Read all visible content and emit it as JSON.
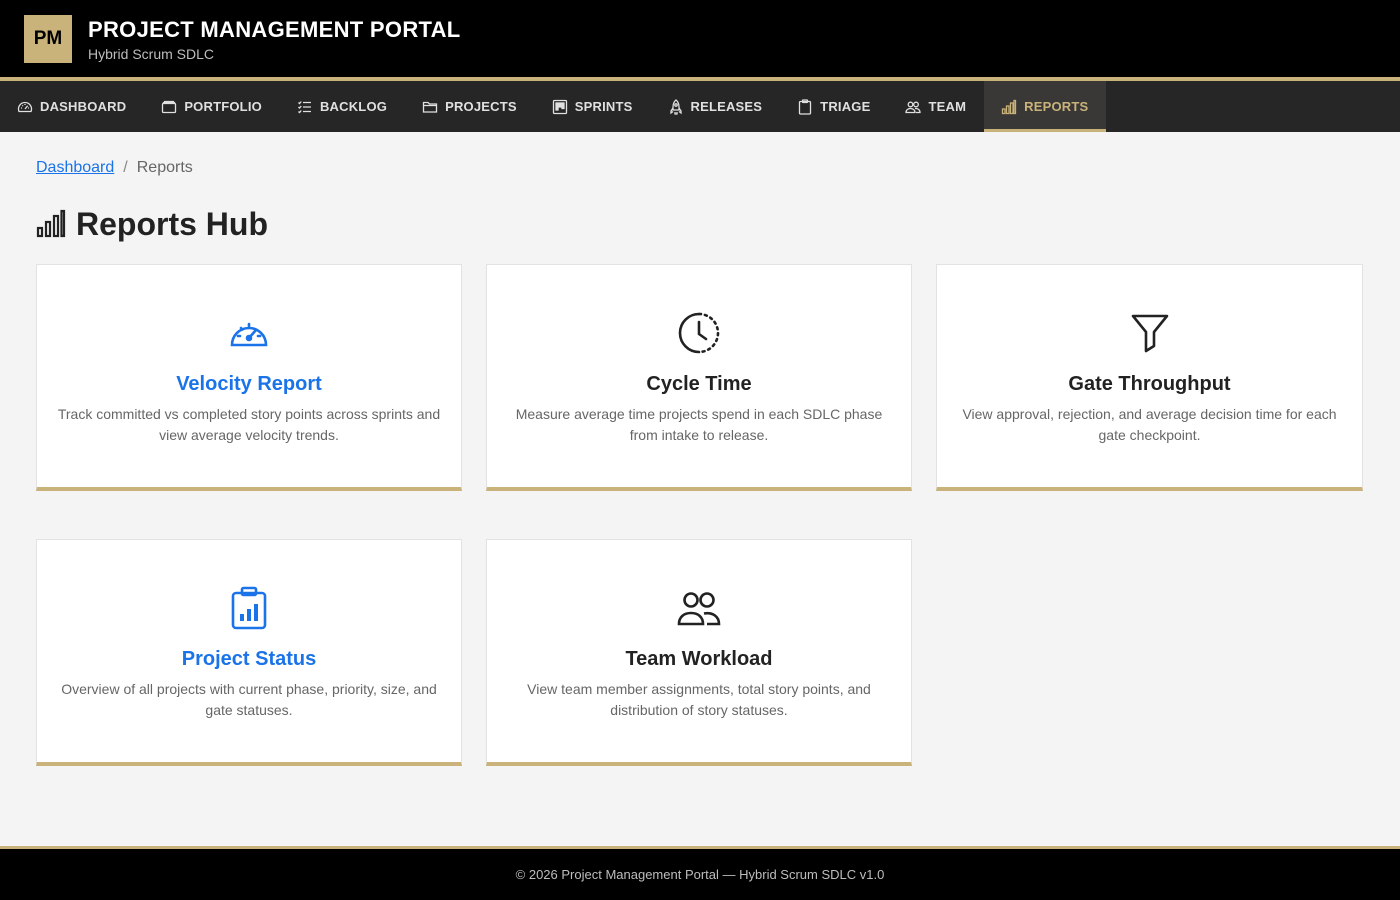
{
  "header": {
    "logo_text": "PM",
    "title": "PROJECT MANAGEMENT PORTAL",
    "subtitle": "Hybrid Scrum SDLC"
  },
  "nav": {
    "items": [
      {
        "label": "DASHBOARD",
        "icon": "speedometer-icon"
      },
      {
        "label": "PORTFOLIO",
        "icon": "briefcase-icon"
      },
      {
        "label": "BACKLOG",
        "icon": "list-check-icon"
      },
      {
        "label": "PROJECTS",
        "icon": "folder-icon"
      },
      {
        "label": "SPRINTS",
        "icon": "kanban-icon"
      },
      {
        "label": "RELEASES",
        "icon": "rocket-icon"
      },
      {
        "label": "TRIAGE",
        "icon": "clipboard-icon"
      },
      {
        "label": "TEAM",
        "icon": "people-icon"
      },
      {
        "label": "REPORTS",
        "icon": "bar-chart-icon",
        "active": true
      }
    ]
  },
  "breadcrumb": {
    "link": "Dashboard",
    "separator": "/",
    "current": "Reports"
  },
  "page": {
    "title": "Reports Hub",
    "title_icon": "bar-chart-icon"
  },
  "cards": [
    {
      "title": "Velocity Report",
      "description": "Track committed vs completed story points across sprints and view average velocity trends.",
      "icon": "speedometer-icon",
      "accent": "#1a73e8"
    },
    {
      "title": "Cycle Time",
      "description": "Measure average time projects spend in each SDLC phase from intake to release.",
      "icon": "clock-history-icon",
      "accent": "#222222"
    },
    {
      "title": "Gate Throughput",
      "description": "View approval, rejection, and average decision time for each gate checkpoint.",
      "icon": "funnel-icon",
      "accent": "#222222"
    },
    {
      "title": "Project Status",
      "description": "Overview of all projects with current phase, priority, size, and gate statuses.",
      "icon": "clipboard-data-icon",
      "accent": "#1a73e8"
    },
    {
      "title": "Team Workload",
      "description": "View team member assignments, total story points, and distribution of story statuses.",
      "icon": "people-icon",
      "accent": "#222222"
    }
  ],
  "footer": {
    "text": "© 2026 Project Management Portal — Hybrid Scrum SDLC v1.0"
  },
  "colors": {
    "gold": "#c9b37a",
    "link_blue": "#1a73e8",
    "header_bg": "#000000",
    "nav_bg": "#262626"
  }
}
